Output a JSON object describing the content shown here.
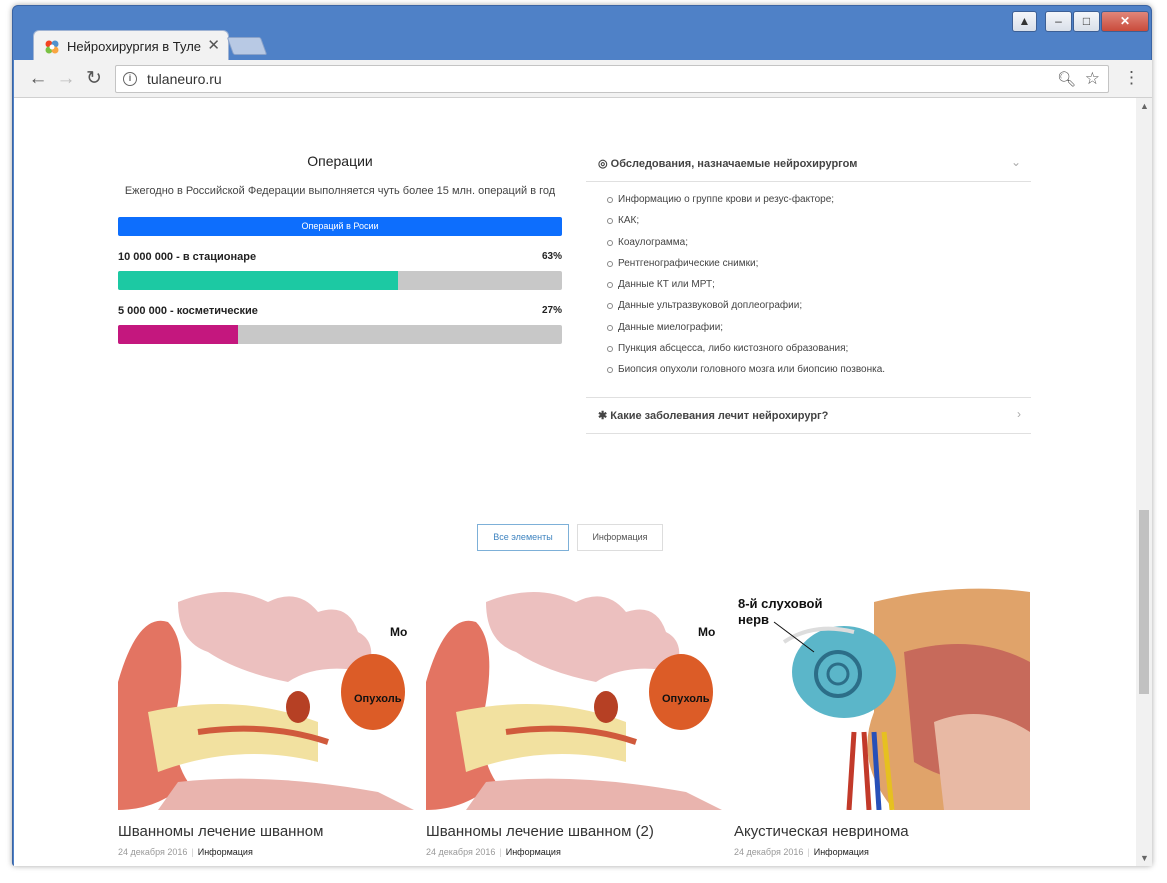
{
  "browser": {
    "tab_title": "Нейрохирургия в Туле,",
    "url": "tulaneuro.ru"
  },
  "operations": {
    "title": "Операции",
    "description": "Ежегодно в Российской Федерации выполняется чуть более 15 млн. операций в год",
    "header_bar": "Операций в Росии",
    "bars": [
      {
        "label": "10 000 000 - в стационаре",
        "percent_text": "63%",
        "value": 63,
        "color": "#1cc9a3"
      },
      {
        "label": "5 000 000 - косметические",
        "percent_text": "27%",
        "value": 27,
        "color": "#c4177e"
      }
    ]
  },
  "accordion": {
    "item1_title": "◎ Обследования, назначаемые нейрохирургом",
    "item1_list": [
      "Информацию о группе крови и резус-факторе;",
      "КАК;",
      "Коаулограмма;",
      "Рентгенографические снимки;",
      "Данные КТ или МРТ;",
      "Данные ультразвуковой доплеографии;",
      "Данные миелографии;",
      "Пункция абсцесса, либо кистозного образования;",
      "Биопсия опухоли головного мозга или биопсию позвонка."
    ],
    "item2_title": "✱ Какие заболевания лечит нейрохирург?"
  },
  "filters": {
    "all": "Все элементы",
    "info": "Информация"
  },
  "cards": [
    {
      "title": "Шванномы лечение шванном",
      "date": "24 декабря 2016",
      "category": "Информация",
      "img_label1": "Мо",
      "img_label2": "Опухоль"
    },
    {
      "title": "Шванномы лечение шванном (2)",
      "date": "24 декабря 2016",
      "category": "Информация",
      "img_label1": "Мо",
      "img_label2": "Опухоль"
    },
    {
      "title": "Акустическая невринома",
      "date": "24 декабря 2016",
      "category": "Информация",
      "img_label1": "8-й слуховой",
      "img_label2": "нерв"
    }
  ]
}
